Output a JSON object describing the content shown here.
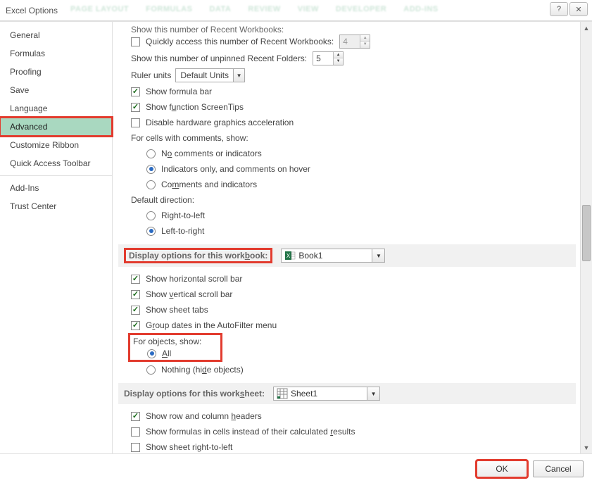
{
  "window": {
    "title": "Excel Options",
    "help_icon": "?",
    "close_icon": "✕"
  },
  "ribbon_faint": [
    "PAGE LAYOUT",
    "FORMULAS",
    "DATA",
    "REVIEW",
    "VIEW",
    "DEVELOPER",
    "ADD-INS"
  ],
  "sidebar": {
    "items": [
      "General",
      "Formulas",
      "Proofing",
      "Save",
      "Language",
      "Advanced",
      "Customize Ribbon",
      "Quick Access Toolbar",
      "Add-Ins",
      "Trust Center"
    ],
    "selected_index": 5
  },
  "cut": {
    "text": "Show this number of Recent Workbooks:"
  },
  "opts": {
    "quick_access_label": "Quickly access this number of Recent Workbooks:",
    "quick_access_value": "4",
    "unpinned_label": "Show this number of unpinned Recent Folders:",
    "unpinned_value": "5",
    "ruler_label": "Ruler units",
    "ruler_value": "Default Units",
    "formula_bar": "Show formula bar",
    "screentips": "Show function ScreenTips",
    "disable_hw": "Disable hardware graphics acceleration",
    "comments_label": "For cells with comments, show:",
    "comments_none_pre": "N",
    "comments_none_u": "o",
    "comments_none_post": " comments or indicators",
    "comments_hover": "Indicators only, and comments on hover",
    "comments_both_pre": "Co",
    "comments_both_u": "m",
    "comments_both_post": "ments and indicators",
    "direction_label": "Default direction:",
    "direction_rtl": "Right-to-left",
    "direction_ltr": "Left-to-right"
  },
  "section_workbook": {
    "label_pre": "Display options for this work",
    "label_u": "b",
    "label_post": "ook:",
    "value": "Book1"
  },
  "wb": {
    "hscroll": "Show horizontal scroll bar",
    "vscroll_pre": "Show ",
    "vscroll_u": "v",
    "vscroll_post": "ertical scroll bar",
    "tabs": "Show sheet tabs",
    "group_pre": "G",
    "group_u": "r",
    "group_post": "oup dates in the AutoFilter menu",
    "objects_label": "For objects, show:",
    "obj_all_u": "A",
    "obj_all_post": "ll",
    "obj_nothing_pre": "Nothing (hi",
    "obj_nothing_u": "d",
    "obj_nothing_post": "e objects)"
  },
  "section_worksheet": {
    "label_pre": "Display options for this work",
    "label_u": "s",
    "label_post": "heet:",
    "value": "Sheet1"
  },
  "ws": {
    "headers_pre": "Show row and column ",
    "headers_u": "h",
    "headers_post": "eaders",
    "formulas_pre": "Show formulas in cells instead of their calculated ",
    "formulas_u": "r",
    "formulas_post": "esults",
    "rtl": "Show sheet right-to-left"
  },
  "footer": {
    "ok": "OK",
    "cancel": "Cancel"
  }
}
